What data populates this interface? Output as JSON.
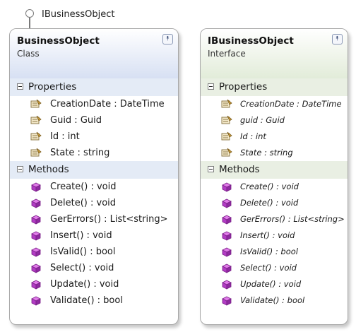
{
  "lollipop": {
    "label": "IBusinessObject"
  },
  "class_shape": {
    "name": "BusinessObject",
    "kind": "Class",
    "properties_title": "Properties",
    "properties": [
      "CreationDate : DateTime",
      "Guid : Guid",
      "Id : int",
      "State : string"
    ],
    "methods_title": "Methods",
    "methods": [
      "Create() : void",
      "Delete() : void",
      "GerErrors() : List<string>",
      "Insert() : void",
      "IsValid() : bool",
      "Select() : void",
      "Update() : void",
      "Validate() : bool"
    ]
  },
  "interface_shape": {
    "name": "IBusinessObject",
    "kind": "Interface",
    "properties_title": "Properties",
    "properties": [
      "CreationDate : DateTime",
      "guid : Guid",
      "Id : int",
      "State : string"
    ],
    "methods_title": "Methods",
    "methods": [
      "Create() : void",
      "Delete() : void",
      "GerErrors() : List<string>",
      "Insert() : void",
      "IsValid() : bool",
      "Select() : void",
      "Update() : void",
      "Validate() : bool"
    ]
  },
  "icons": {
    "collapse": "double-chevron-up-icon",
    "section_toggle": "minus-box-icon",
    "property": "property-hand-icon",
    "method": "method-cube-icon"
  },
  "colors": {
    "class_header": "#d7e0f3",
    "interface_header": "#e2ecd9",
    "method_icon": "#b23cc4",
    "property_icon": "#c79a3a"
  }
}
